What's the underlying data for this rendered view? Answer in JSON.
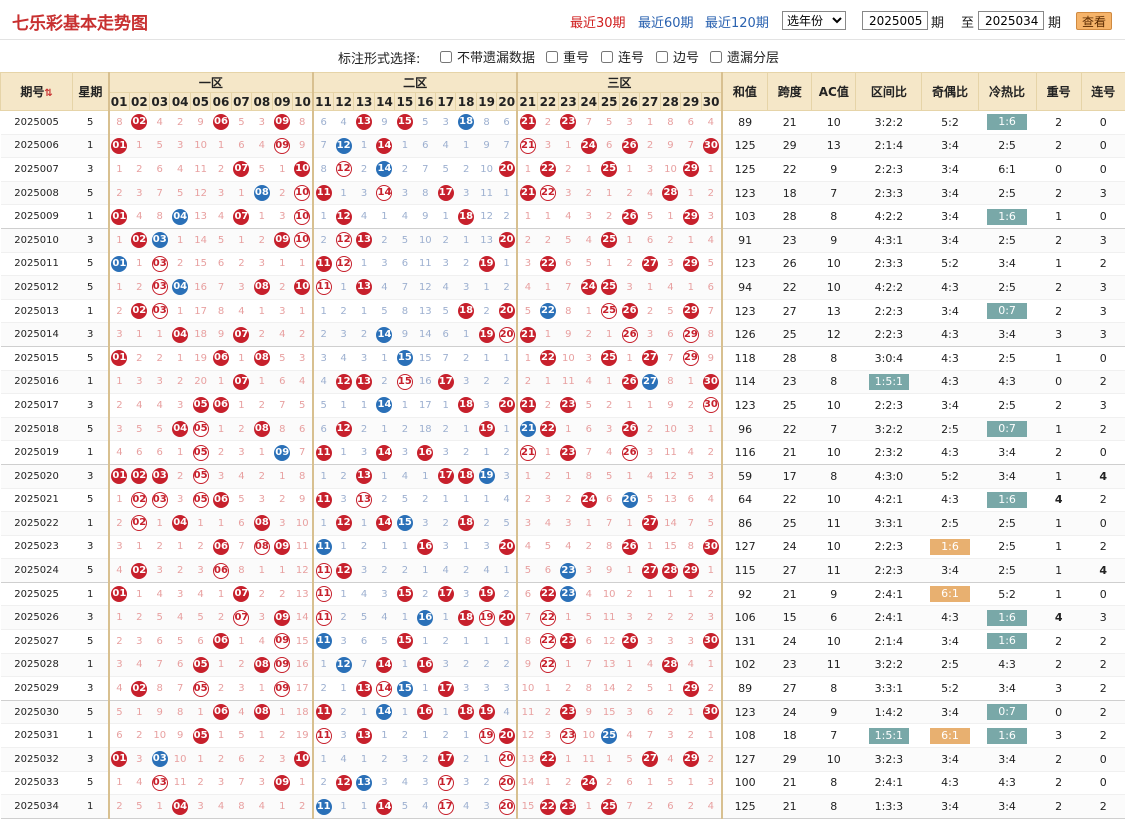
{
  "header": {
    "title": "七乐彩基本走势图",
    "links": [
      "最近30期",
      "最近60期",
      "最近120期"
    ],
    "year_select": "选年份",
    "from": "2025005",
    "to": "2025034",
    "issue_suffix": "期",
    "to_label": "至",
    "view_btn": "查看"
  },
  "options": {
    "label": "标注形式选择:",
    "items": [
      "不带遗漏数据",
      "重号",
      "连号",
      "边号",
      "遗漏分层"
    ]
  },
  "columns": {
    "issue": "期号",
    "week": "星期",
    "zones": [
      "一区",
      "二区",
      "三区"
    ],
    "sum": "和值",
    "span": "跨度",
    "ac": "AC值",
    "zoneratio": "区间比",
    "oddeven": "奇偶比",
    "hotcold": "冷热比",
    "rep": "重号",
    "cons": "连号",
    "sort_icon": "sort-arrows-icon"
  },
  "colors": {
    "ball_red": "#c7202c",
    "ball_blue": "#2a70b8",
    "tag_teal": "#79a8a8",
    "tag_orange": "#e8b070",
    "header_bg": "#f5e7c8"
  },
  "rows": [
    {
      "issue": "2025005",
      "week": "5",
      "red": [
        2,
        6,
        9,
        13,
        15,
        21,
        23
      ],
      "blue": [
        18
      ],
      "sum": "89",
      "span": "21",
      "ac": "10",
      "zr": "3:2:2",
      "oe": "5:2",
      "hc": "1:6",
      "hct": "teal",
      "rep": "2",
      "cons": "0"
    },
    {
      "issue": "2025006",
      "week": "1",
      "red": [
        1,
        9,
        14,
        21,
        24,
        26,
        30
      ],
      "blue": [
        12
      ],
      "sum": "125",
      "span": "29",
      "ac": "13",
      "zr": "2:1:4",
      "oe": "3:4",
      "hc": "2:5",
      "rep": "2",
      "cons": "0"
    },
    {
      "issue": "2025007",
      "week": "3",
      "red": [
        7,
        10,
        12,
        20,
        22,
        25,
        29
      ],
      "blue": [
        14
      ],
      "sum": "125",
      "span": "22",
      "ac": "9",
      "zr": "2:2:3",
      "oe": "3:4",
      "hc": "6:1",
      "rep": "0",
      "cons": "0"
    },
    {
      "issue": "2025008",
      "week": "5",
      "red": [
        10,
        11,
        14,
        17,
        21,
        22,
        28
      ],
      "blue": [
        8
      ],
      "sum": "123",
      "span": "18",
      "ac": "7",
      "zr": "2:3:3",
      "oe": "3:4",
      "hc": "2:5",
      "rep": "2",
      "cons": "3"
    },
    {
      "issue": "2025009",
      "week": "1",
      "red": [
        1,
        7,
        10,
        12,
        18,
        26,
        29
      ],
      "blue": [
        4
      ],
      "sum": "103",
      "span": "28",
      "ac": "8",
      "zr": "4:2:2",
      "oe": "3:4",
      "hc": "1:6",
      "hct": "teal",
      "rep": "1",
      "cons": "0"
    },
    {
      "issue": "2025010",
      "week": "3",
      "red": [
        2,
        9,
        10,
        12,
        13,
        20,
        25
      ],
      "blue": [
        3
      ],
      "sum": "91",
      "span": "23",
      "ac": "9",
      "zr": "4:3:1",
      "oe": "3:4",
      "hc": "2:5",
      "rep": "2",
      "cons": "3"
    },
    {
      "issue": "2025011",
      "week": "5",
      "red": [
        3,
        11,
        12,
        19,
        22,
        27,
        29
      ],
      "blue": [
        1
      ],
      "sum": "123",
      "span": "26",
      "ac": "10",
      "zr": "2:3:3",
      "oe": "5:2",
      "hc": "3:4",
      "rep": "1",
      "cons": "2"
    },
    {
      "issue": "2025012",
      "week": "5",
      "red": [
        3,
        8,
        10,
        11,
        13,
        24,
        25
      ],
      "blue": [
        4
      ],
      "sum": "94",
      "span": "22",
      "ac": "10",
      "zr": "4:2:2",
      "oe": "4:3",
      "hc": "2:5",
      "rep": "2",
      "cons": "3"
    },
    {
      "issue": "2025013",
      "week": "1",
      "red": [
        2,
        3,
        18,
        20,
        25,
        26,
        29
      ],
      "blue": [
        22
      ],
      "sum": "123",
      "span": "27",
      "ac": "13",
      "zr": "2:2:3",
      "oe": "3:4",
      "hc": "0:7",
      "hct": "teal",
      "rep": "2",
      "cons": "3"
    },
    {
      "issue": "2025014",
      "week": "3",
      "red": [
        4,
        7,
        19,
        20,
        21,
        26,
        29
      ],
      "blue": [
        14
      ],
      "sum": "126",
      "span": "25",
      "ac": "12",
      "zr": "2:2:3",
      "oe": "4:3",
      "hc": "3:4",
      "rep": "3",
      "cons": "3"
    },
    {
      "issue": "2025015",
      "week": "5",
      "red": [
        1,
        6,
        8,
        22,
        25,
        27,
        29
      ],
      "blue": [
        15
      ],
      "sum": "118",
      "span": "28",
      "ac": "8",
      "zr": "3:0:4",
      "oe": "4:3",
      "hc": "2:5",
      "rep": "1",
      "cons": "0"
    },
    {
      "issue": "2025016",
      "week": "1",
      "red": [
        7,
        12,
        13,
        15,
        17,
        26,
        30
      ],
      "blue": [
        27
      ],
      "sum": "114",
      "span": "23",
      "ac": "8",
      "zr": "1:5:1",
      "zrt": "teal",
      "oe": "4:3",
      "hc": "4:3",
      "rep": "0",
      "cons": "2"
    },
    {
      "issue": "2025017",
      "week": "3",
      "red": [
        5,
        6,
        18,
        20,
        21,
        23,
        30
      ],
      "blue": [
        14
      ],
      "sum": "123",
      "span": "25",
      "ac": "10",
      "zr": "2:2:3",
      "oe": "3:4",
      "hc": "2:5",
      "rep": "2",
      "cons": "3"
    },
    {
      "issue": "2025018",
      "week": "5",
      "red": [
        4,
        5,
        8,
        12,
        19,
        22,
        26
      ],
      "blue": [
        21
      ],
      "sum": "96",
      "span": "22",
      "ac": "7",
      "zr": "3:2:2",
      "oe": "2:5",
      "hc": "0:7",
      "hct": "teal",
      "rep": "1",
      "cons": "2"
    },
    {
      "issue": "2025019",
      "week": "1",
      "red": [
        5,
        11,
        14,
        16,
        21,
        23,
        26
      ],
      "blue": [
        9
      ],
      "sum": "116",
      "span": "21",
      "ac": "10",
      "zr": "2:3:2",
      "oe": "4:3",
      "hc": "3:4",
      "rep": "2",
      "cons": "0"
    },
    {
      "issue": "2025020",
      "week": "3",
      "red": [
        1,
        2,
        3,
        5,
        13,
        17,
        18
      ],
      "blue": [
        19
      ],
      "sum": "59",
      "span": "17",
      "ac": "8",
      "zr": "4:3:0",
      "oe": "5:2",
      "hc": "3:4",
      "rep": "1",
      "cons": "4",
      "ccls": "teal4"
    },
    {
      "issue": "2025021",
      "week": "5",
      "red": [
        2,
        3,
        5,
        6,
        11,
        13,
        24
      ],
      "blue": [
        26
      ],
      "sum": "64",
      "span": "22",
      "ac": "10",
      "zr": "4:2:1",
      "oe": "4:3",
      "hc": "1:6",
      "hct": "teal",
      "rep": "4",
      "rcls": "red4",
      "cons": "2"
    },
    {
      "issue": "2025022",
      "week": "1",
      "red": [
        2,
        4,
        8,
        12,
        14,
        18,
        27
      ],
      "blue": [
        15
      ],
      "sum": "86",
      "span": "25",
      "ac": "11",
      "zr": "3:3:1",
      "oe": "2:5",
      "hc": "2:5",
      "rep": "1",
      "cons": "0"
    },
    {
      "issue": "2025023",
      "week": "3",
      "red": [
        6,
        8,
        16,
        20,
        26,
        30,
        9
      ],
      "blue": [
        11
      ],
      "sum": "127",
      "span": "24",
      "ac": "10",
      "zr": "2:2:3",
      "oe": "1:6",
      "oet": "or",
      "hc": "2:5",
      "rep": "1",
      "cons": "2"
    },
    {
      "issue": "2025024",
      "week": "5",
      "red": [
        2,
        6,
        11,
        12,
        27,
        28,
        29
      ],
      "blue": [
        23
      ],
      "sum": "115",
      "span": "27",
      "ac": "11",
      "zr": "2:2:3",
      "oe": "3:4",
      "hc": "2:5",
      "rep": "1",
      "cons": "4",
      "ccls": "teal4"
    },
    {
      "issue": "2025025",
      "week": "1",
      "red": [
        1,
        7,
        11,
        15,
        17,
        19,
        22
      ],
      "blue": [
        23
      ],
      "sum": "92",
      "span": "21",
      "ac": "9",
      "zr": "2:4:1",
      "oe": "6:1",
      "oet": "or",
      "hc": "5:2",
      "rep": "1",
      "cons": "0"
    },
    {
      "issue": "2025026",
      "week": "3",
      "red": [
        7,
        9,
        11,
        18,
        19,
        20,
        22
      ],
      "blue": [
        16
      ],
      "sum": "106",
      "span": "15",
      "ac": "6",
      "zr": "2:4:1",
      "oe": "4:3",
      "hc": "1:6",
      "hct": "teal",
      "rep": "4",
      "rcls": "red4",
      "cons": "3"
    },
    {
      "issue": "2025027",
      "week": "5",
      "red": [
        6,
        9,
        15,
        22,
        23,
        26,
        30
      ],
      "blue": [
        11
      ],
      "sum": "131",
      "span": "24",
      "ac": "10",
      "zr": "2:1:4",
      "oe": "3:4",
      "hc": "1:6",
      "hct": "teal",
      "rep": "2",
      "cons": "2"
    },
    {
      "issue": "2025028",
      "week": "1",
      "red": [
        5,
        8,
        9,
        14,
        16,
        22,
        28
      ],
      "blue": [
        12
      ],
      "sum": "102",
      "span": "23",
      "ac": "11",
      "zr": "3:2:2",
      "oe": "2:5",
      "hc": "4:3",
      "rep": "2",
      "cons": "2"
    },
    {
      "issue": "2025029",
      "week": "3",
      "red": [
        2,
        5,
        9,
        13,
        14,
        17,
        29
      ],
      "blue": [
        15
      ],
      "sum": "89",
      "span": "27",
      "ac": "8",
      "zr": "3:3:1",
      "oe": "5:2",
      "hc": "3:4",
      "rep": "3",
      "cons": "2"
    },
    {
      "issue": "2025030",
      "week": "5",
      "red": [
        6,
        8,
        11,
        16,
        18,
        19,
        23,
        30
      ],
      "blue": [
        14
      ],
      "sum": "123",
      "span": "24",
      "ac": "9",
      "zr": "1:4:2",
      "oe": "3:4",
      "hc": "0:7",
      "hct": "teal",
      "rep": "0",
      "cons": "2"
    },
    {
      "issue": "2025031",
      "week": "1",
      "red": [
        5,
        11,
        13,
        19,
        20,
        23
      ],
      "blue": [
        25
      ],
      "sum": "108",
      "span": "18",
      "ac": "7",
      "zr": "1:5:1",
      "zrt": "teal",
      "oe": "6:1",
      "oet": "or",
      "hc": "1:6",
      "hct": "teal",
      "rep": "3",
      "cons": "2"
    },
    {
      "issue": "2025032",
      "week": "3",
      "red": [
        1,
        10,
        17,
        20,
        22,
        27,
        29
      ],
      "blue": [
        3
      ],
      "sum": "127",
      "span": "29",
      "ac": "10",
      "zr": "3:2:3",
      "oe": "3:4",
      "hc": "3:4",
      "rep": "2",
      "cons": "0"
    },
    {
      "issue": "2025033",
      "week": "5",
      "red": [
        3,
        9,
        12,
        13,
        17,
        20,
        24
      ],
      "blue": [
        13
      ],
      "sum": "100",
      "span": "21",
      "ac": "8",
      "zr": "2:4:1",
      "oe": "4:3",
      "hc": "4:3",
      "rep": "2",
      "cons": "0"
    },
    {
      "issue": "2025034",
      "week": "1",
      "red": [
        4,
        14,
        17,
        20,
        22,
        23,
        25
      ],
      "blue": [
        11
      ],
      "sum": "125",
      "span": "21",
      "ac": "8",
      "zr": "1:3:3",
      "oe": "3:4",
      "hc": "3:4",
      "rep": "2",
      "cons": "2"
    }
  ]
}
